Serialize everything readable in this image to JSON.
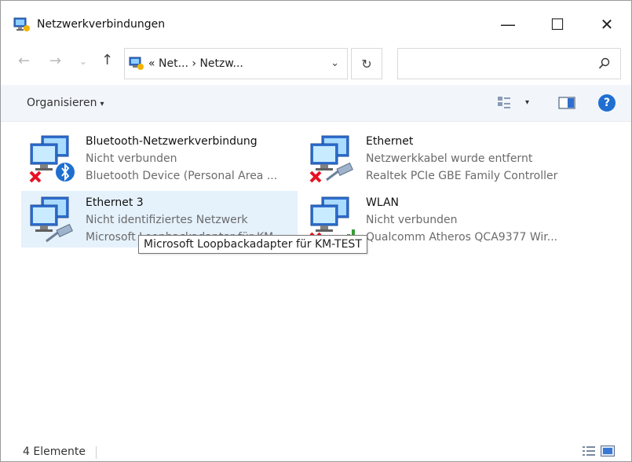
{
  "window": {
    "title": "Netzwerkverbindungen",
    "icon": "network-connections-icon",
    "controls": {
      "minimize": "—",
      "maximize": "☐",
      "close": "✕"
    }
  },
  "nav": {
    "back": "←",
    "forward": "→",
    "recent": "⌄",
    "up": "↑",
    "address": "« Net...  ›  Netzw...",
    "address_drop": "⌄",
    "refresh": "↻",
    "search_placeholder": ""
  },
  "command": {
    "organize": "Organisieren",
    "organize_caret": "▾",
    "view_caret": "▾",
    "help": "?"
  },
  "items": [
    {
      "name": "Bluetooth-Netzwerkverbindung",
      "status": "Nicht verbunden",
      "device": "Bluetooth Device (Personal Area ...",
      "state": "disconnected",
      "overlay": "bluetooth"
    },
    {
      "name": "Ethernet",
      "status": "Netzwerkkabel wurde entfernt",
      "device": "Realtek PCIe GBE Family Controller",
      "state": "disconnected",
      "overlay": "cable"
    },
    {
      "name": "Ethernet 3",
      "status": "Nicht identifiziertes Netzwerk",
      "device": "Microsoft Loopbackadapter für KM...",
      "state": "connected",
      "overlay": "cable"
    },
    {
      "name": "WLAN",
      "status": "Nicht verbunden",
      "device": "Qualcomm Atheros QCA9377 Wir...",
      "state": "disconnected",
      "overlay": "wifi"
    }
  ],
  "tooltip": "Microsoft Loopbackadapter für KM-TEST",
  "status": {
    "count": "4 Elemente"
  },
  "colors": {
    "selection": "#e5f1fb",
    "accent": "#1f6fd1",
    "error": "#e81123",
    "wifi": "#3a9d3a"
  }
}
